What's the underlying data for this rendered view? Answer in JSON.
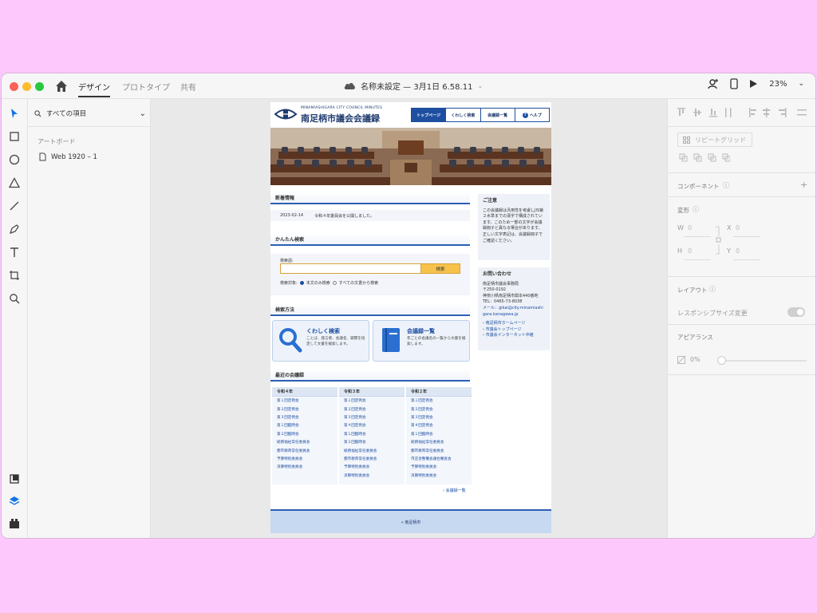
{
  "titlebar": {
    "tabs": [
      "デザイン",
      "プロトタイプ",
      "共有"
    ],
    "document": "名称未設定 — 3月1日 6.58.11",
    "zoom": "23%"
  },
  "layers": {
    "search_label": "すべての項目",
    "section": "アートボード",
    "artboard": "Web 1920 – 1"
  },
  "props": {
    "repeat_grid": "リピートグリッド",
    "component": "コンポーネント",
    "transform": "変形",
    "w_label": "W",
    "w_value": "0",
    "h_label": "H",
    "h_value": "0",
    "x_label": "X",
    "x_value": "0",
    "y_label": "Y",
    "y_value": "0",
    "layout": "レイアウト",
    "responsive": "レスポンシブサイズ変更",
    "appearance": "アピアランス",
    "opacity": "0%"
  },
  "site": {
    "subtitle": "MINAMIASHIGARA CITY COUNCIL MINUTES",
    "title": "南足柄市議会会議録",
    "nav": [
      "トップページ",
      "くわしく検索",
      "会議録一覧",
      "ヘルプ"
    ],
    "news": {
      "heading": "新着情報",
      "date": "2023-02-14",
      "text": "令和４年委員会を公開しました。"
    },
    "simple_search": {
      "heading": "かんたん検索",
      "label": "検索語:",
      "button": "検索",
      "target_label": "検索対象:",
      "opt1": "本文のみ検索",
      "opt2": "すべての文書から検索"
    },
    "method": {
      "heading": "検索方法",
      "card1_title": "くわしく検索",
      "card1_desc": "ことば、発言者、会議名、期間を指定して文書を検索します。",
      "card2_title": "会議録一覧",
      "card2_desc": "年ごとの会議名の一覧から文書を検索します。"
    },
    "recent": {
      "heading": "最近の会議録",
      "columns": [
        {
          "year": "令和４年",
          "items": [
            "第１回定例会",
            "第２回定例会",
            "第３回定例会",
            "第１回臨時会",
            "第２回臨時会",
            "総務福祉常任委員会",
            "都市教育常任委員会",
            "予算特別委員会",
            "決算特別委員会"
          ]
        },
        {
          "year": "令和３年",
          "items": [
            "第１回定例会",
            "第２回定例会",
            "第３回定例会",
            "第４回定例会",
            "第１回臨時会",
            "第２回臨時会",
            "総務福祉常任委員会",
            "都市教育常任委員会",
            "予算特別委員会",
            "決算特別委員会"
          ]
        },
        {
          "year": "令和２年",
          "items": [
            "第１回定例会",
            "第２回定例会",
            "第３回定例会",
            "第４回定例会",
            "第１回臨時会",
            "総務福祉常任委員会",
            "都市教育常任委員会",
            "市庄舎整備会議合審査会",
            "予算特別委員会",
            "決算特別委員会"
          ]
        }
      ],
      "more": "会議録一覧"
    },
    "notice": {
      "heading": "ご注意",
      "text": "この会議録は汎用性を考慮しJIS第２水準までの漢字で構成されています。このため一部の文字が会議録冊子と異なる場合があります。正しい文字表記は、会議録冊子でご確認ください。"
    },
    "contact": {
      "heading": "お問い合わせ",
      "lines": [
        "南足柄市議会事務局",
        "〒250-0192",
        "神奈川県南足柄市関本440番地",
        "TEL：0465-73-8038",
        "メール：gikai@city.minamiashigara.kanagawa.jp"
      ],
      "links": [
        "南足柄市ホームページ",
        "市議会トップページ",
        "市議会インターネット中継"
      ]
    },
    "footer": "« 南足柄市"
  }
}
